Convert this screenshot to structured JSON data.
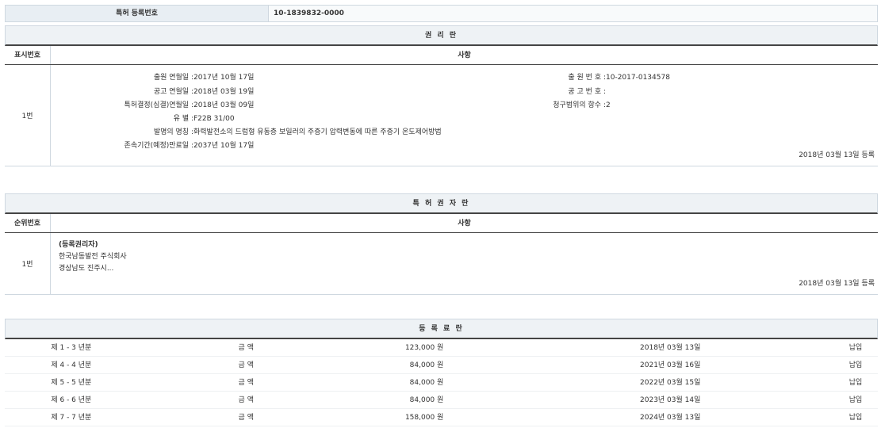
{
  "registration": {
    "label": "특허 등록번호",
    "value": "10-1839832-0000"
  },
  "rights_section": {
    "title": "권 리 란",
    "col_num": "표시번호",
    "col_detail": "사항",
    "row_num": "1번",
    "left_fields": [
      {
        "key": "출원 연월일",
        "value": "2017년 10월 17일"
      },
      {
        "key": "공고 연월일",
        "value": "2018년 03월 19일"
      },
      {
        "key": "특허결정(심결)연월일",
        "value": "2018년 03월 09일"
      },
      {
        "key": "유 별",
        "value": "F22B 31/00"
      },
      {
        "key": "발명의 명칭",
        "value": "화력발전소의 드럼형 유동층 보일러의 주증기 압력변동에 따른 주증기 온도제어방법"
      },
      {
        "key": "존속기간(예정)만료일",
        "value": "2037년 10월 17일"
      }
    ],
    "right_fields": [
      {
        "key": "출 원 번 호",
        "value": "10-2017-0134578"
      },
      {
        "key": "공 고 번 호",
        "value": ""
      },
      {
        "key": "청구범위의 항수",
        "value": "2"
      }
    ],
    "reg_date": "2018년 03월 13일 등록"
  },
  "holder_section": {
    "title": "특 허 권 자 란",
    "col_num": "순위번호",
    "col_detail": "사항",
    "row_num": "1번",
    "lines": [
      "(등록권리자)",
      "한국남동발전 주식회사",
      "경상남도 진주시..."
    ],
    "reg_date": "2018년 03월 13일 등록"
  },
  "fee_section": {
    "title": "등 록 료 란",
    "rows": [
      {
        "years": "제 1 - 3 년분",
        "label": "금 액",
        "amount": "123,000 원",
        "date": "2018년 03월 13일",
        "status": "납입"
      },
      {
        "years": "제 4 - 4 년분",
        "label": "금 액",
        "amount": "84,000 원",
        "date": "2021년 03월 16일",
        "status": "납입"
      },
      {
        "years": "제 5 - 5 년분",
        "label": "금 액",
        "amount": "84,000 원",
        "date": "2022년 03월 15일",
        "status": "납입"
      },
      {
        "years": "제 6 - 6 년분",
        "label": "금 액",
        "amount": "84,000 원",
        "date": "2023년 03월 14일",
        "status": "납입"
      },
      {
        "years": "제 7 - 7 년분",
        "label": "금 액",
        "amount": "158,000 원",
        "date": "2024년 03월 13일",
        "status": "납입"
      }
    ]
  }
}
